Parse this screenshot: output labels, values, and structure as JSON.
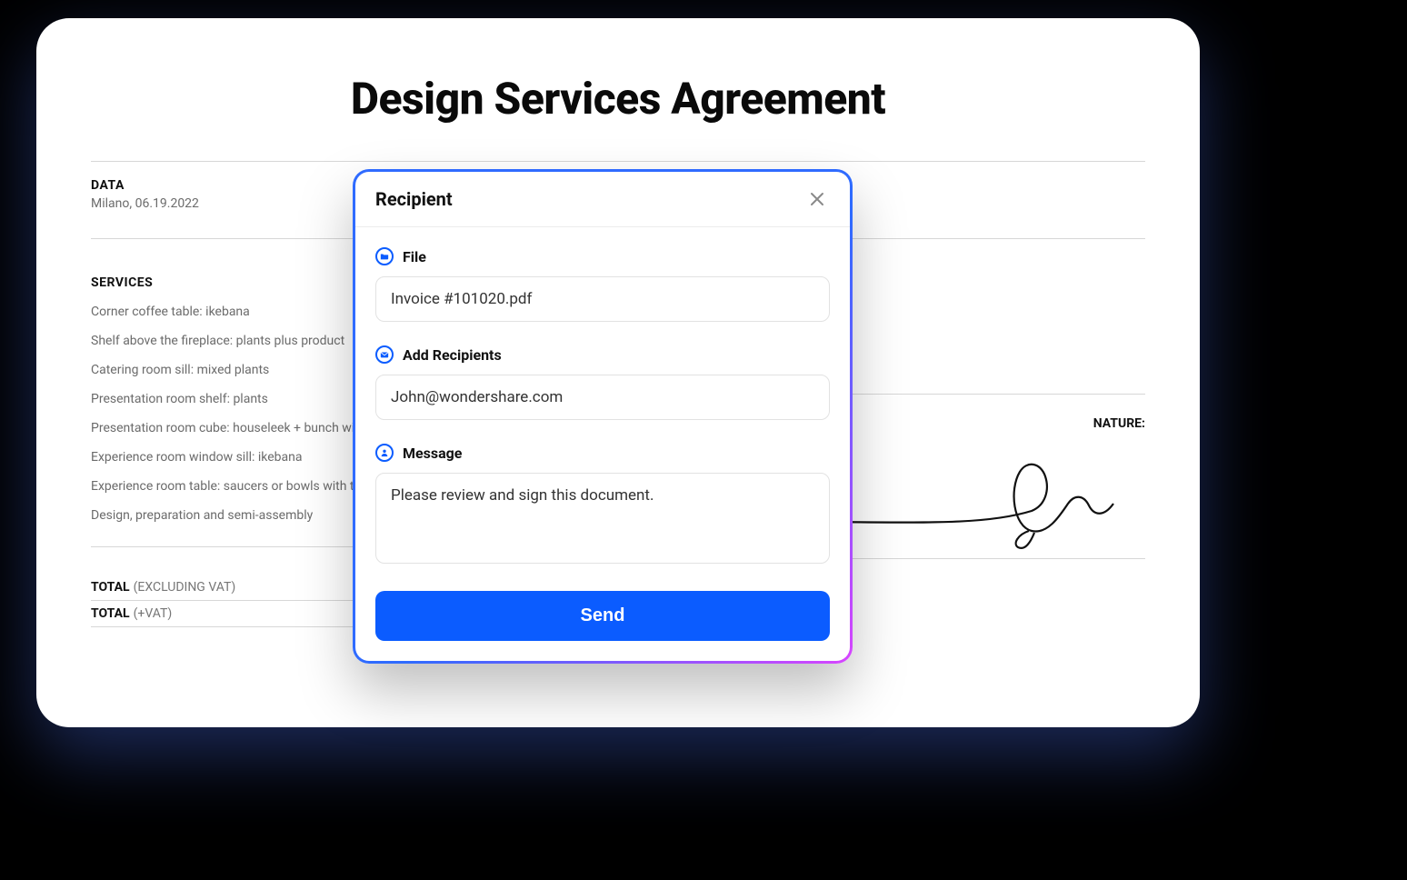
{
  "document": {
    "title": "Design Services Agreement",
    "data_label": "DATA",
    "data_value": "Milano, 06.19.2022",
    "services_label": "SERVICES",
    "services": [
      "Corner coffee table: ikebana",
      "Shelf above the fireplace: plants plus product",
      "Catering room sill: mixed plants",
      "Presentation room shelf: plants",
      "Presentation room cube: houseleek + bunch with the",
      "Experience room window sill: ikebana",
      "Experience room table: saucers or bowls with the",
      "Design, preparation and semi-assembly"
    ],
    "signature_label": "NATURE:",
    "totals": {
      "row1_key": "TOTAL",
      "row1_sub": "(EXCLUDING VAT)",
      "row2_key": "TOTAL",
      "row2_sub": "(+VAT)"
    }
  },
  "modal": {
    "title": "Recipient",
    "file_label": "File",
    "file_value": "Invoice #101020.pdf",
    "recipients_label": "Add Recipients",
    "recipients_value": "John@wondershare.com",
    "message_label": "Message",
    "message_value": "Please review and sign this document.",
    "send_label": "Send"
  }
}
